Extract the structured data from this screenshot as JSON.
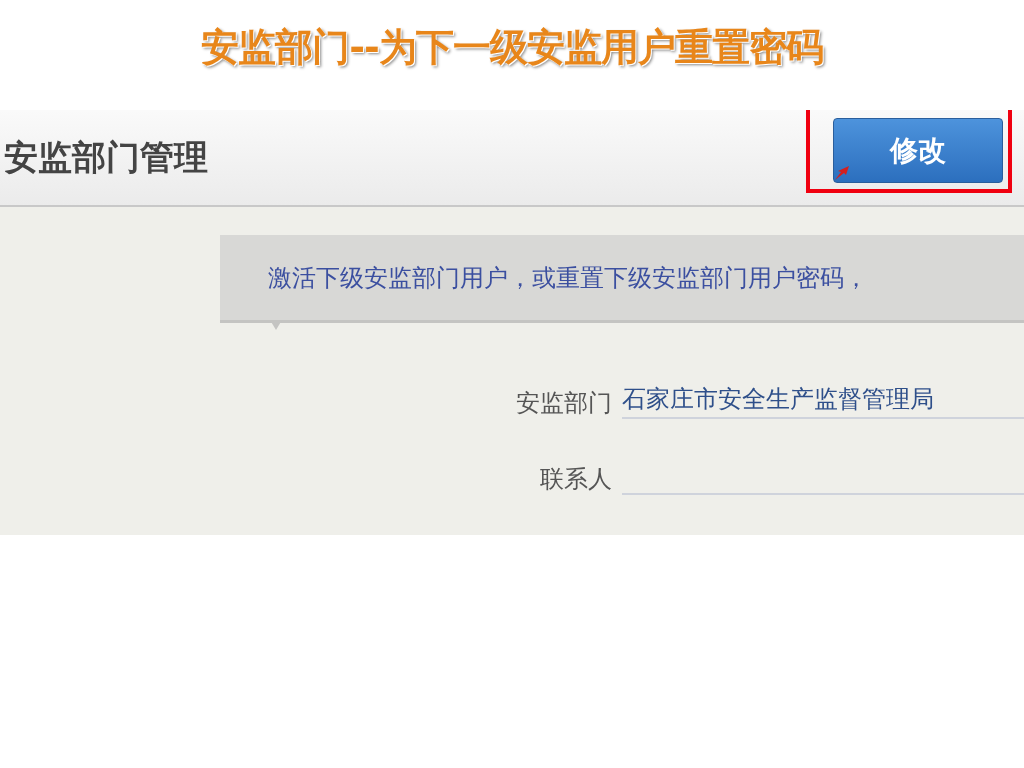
{
  "slide_title": "安监部门--为下一级安监用户重置密码",
  "page": {
    "title": "安监部门管理",
    "edit_button": {
      "label": "修改",
      "highlighted": true
    },
    "notice": "激活下级安监部门用户，或重置下级安监部门用户密码，",
    "fields": [
      {
        "label": "安监部门",
        "value": "石家庄市安全生产监督管理局"
      },
      {
        "label": "联系人"
      }
    ]
  }
}
